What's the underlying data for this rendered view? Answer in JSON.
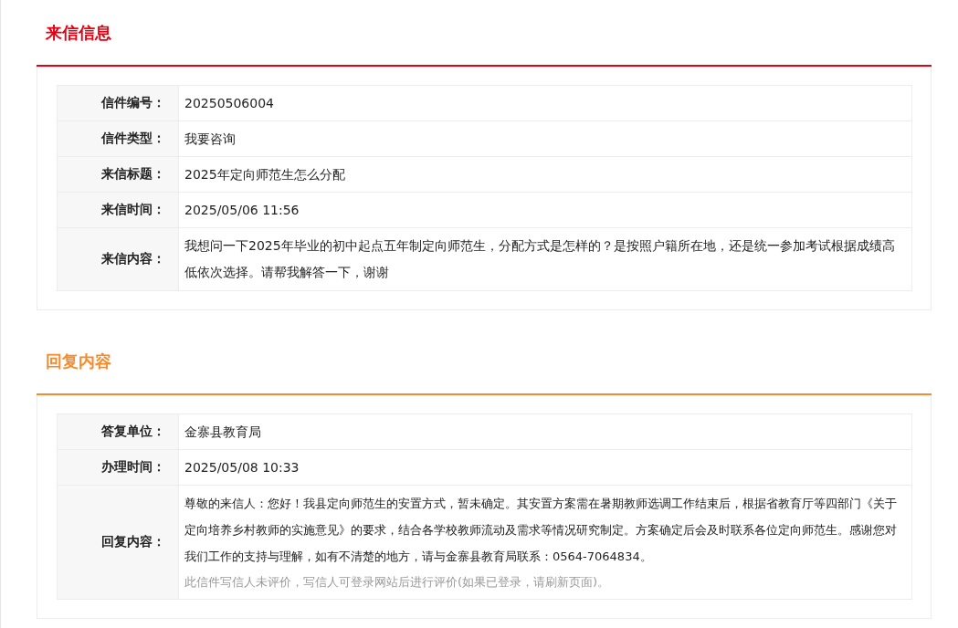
{
  "sections": [
    {
      "title": "来信信息",
      "color": "#e60012",
      "rows": [
        {
          "label": "信件编号：",
          "value": "20250506004"
        },
        {
          "label": "信件类型：",
          "value": "我要咨询"
        },
        {
          "label": "来信标题：",
          "value": "2025年定向师范生怎么分配"
        },
        {
          "label": "来信时间：",
          "value": "2025/05/06 11:56"
        },
        {
          "label": "来信内容：",
          "value": "我想问一下2025年毕业的初中起点五年制定向师范生，分配方式是怎样的？是按照户籍所在地，还是统一参加考试根据成绩高低依次选择。请帮我解答一下，谢谢",
          "kind": "long"
        }
      ]
    },
    {
      "title": "回复内容",
      "color": "#f68b2e",
      "rows": [
        {
          "label": "答复单位：",
          "value": "金寨县教育局"
        },
        {
          "label": "办理时间：",
          "value": "2025/05/08 10:33"
        },
        {
          "label": "回复内容：",
          "value": "尊敬的来信人：您好！我县定向师范生的安置方式，暂未确定。其安置方案需在暑期教师选调工作结束后，根据省教育厅等四部门《关于定向培养乡村教师的实施意见》的要求，结合各学校教师流动及需求等情况研究制定。方案确定后会及时联系各位定向师范生。感谢您对我们工作的支持与理解，如有不清楚的地方，请与金寨县教育局联系：0564-7064834。",
          "kind": "reply",
          "note": "此信件写信人未评价，写信人可登录网站后进行评价(如果已登录，请刷新页面)。"
        }
      ]
    }
  ]
}
